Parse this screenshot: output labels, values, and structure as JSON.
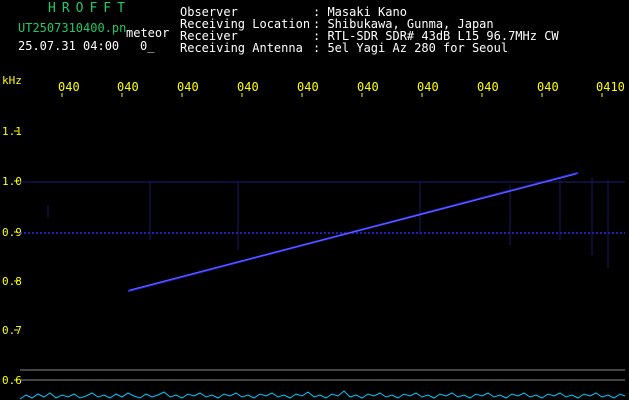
{
  "header": {
    "brand": "HROFFT",
    "filename": "UT2507310400.pn",
    "mode": "meteor",
    "datetime": "25.07.31 04:00",
    "count": "0_"
  },
  "meta": [
    {
      "key": "Observer",
      "value": ": Masaki Kano"
    },
    {
      "key": "Receiving Location",
      "value": ": Shibukawa, Gunma, Japan"
    },
    {
      "key": "Receiver",
      "value": ": RTL-SDR SDR# 43dB L15 96.7MHz CW"
    },
    {
      "key": "Receiving Antenna",
      "value": ": 5el Yagi Az 280 for Seoul"
    }
  ],
  "time_ticks": [
    "040",
    "040",
    "040",
    "040",
    "040",
    "040",
    "040",
    "040",
    "040",
    "0410"
  ],
  "y_axis": {
    "unit": "kHz",
    "labels": [
      "1.1",
      "1.0",
      "0.9",
      "0.8",
      "0.7",
      "0.6"
    ]
  },
  "colors": {
    "meta_text": "#ffffff",
    "brand": "#22c864",
    "ticks": "#ffff00",
    "trace": "#2a2aff",
    "noise": "#00c8ff"
  }
}
